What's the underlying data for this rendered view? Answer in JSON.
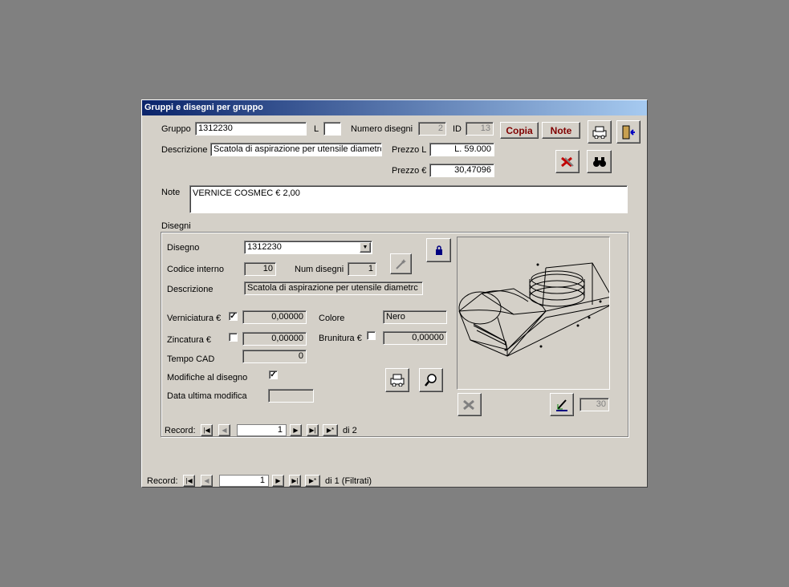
{
  "window": {
    "title": "Gruppi e disegni per gruppo"
  },
  "header": {
    "gruppo_label": "Gruppo",
    "gruppo_value": "1312230",
    "l_label": "L",
    "l_value": "",
    "numero_disegni_label": "Numero disegni",
    "numero_disegni_value": "2",
    "id_label": "ID",
    "id_value": "13",
    "copia_label": "Copia",
    "note_button_label": "Note",
    "descrizione_label": "Descrizione",
    "descrizione_value": "Scatola di aspirazione per utensile diametrc",
    "prezzo_l_label": "Prezzo L",
    "prezzo_l_value": "L. 59.000",
    "prezzo_e_label": "Prezzo €",
    "prezzo_e_value": "30,47096",
    "note_label": "Note",
    "note_value": "VERNICE COSMEC € 2,00"
  },
  "disegni": {
    "section_label": "Disegni",
    "disegno_label": "Disegno",
    "disegno_value": "1312230",
    "codice_interno_label": "Codice interno",
    "codice_interno_value": "10",
    "num_disegni_label": "Num disegni",
    "num_disegni_value": "1",
    "descrizione_label": "Descrizione",
    "descrizione_value": "Scatola di aspirazione per utensile diametrc",
    "verniciatura_label": "Verniciatura €",
    "verniciatura_checked": true,
    "verniciatura_value": "0,00000",
    "colore_label": "Colore",
    "colore_value": "Nero",
    "zincatura_label": "Zincatura €",
    "zincatura_checked": false,
    "zincatura_value": "0,00000",
    "brunitura_label": "Brunitura €",
    "brunitura_checked": false,
    "brunitura_value": "0,00000",
    "tempo_cad_label": "Tempo CAD",
    "tempo_cad_value": "0",
    "modifiche_label": "Modifiche al disegno",
    "modifiche_checked": true,
    "data_ultima_label": "Data ultima modifica",
    "data_ultima_value": "",
    "picture_counter": "30",
    "record_label": "Record:",
    "record_value": "1",
    "record_total": "di 2"
  },
  "footer": {
    "record_label": "Record:",
    "record_value": "1",
    "record_total": "di 1 (Filtrati)"
  },
  "icons": [
    "print-icon",
    "exit-door-icon",
    "delete-icon",
    "binoculars-icon",
    "lock-icon",
    "wand-icon",
    "zoom-icon",
    "delete-disabled-icon",
    "edit-drawing-icon",
    "first-icon",
    "prev-icon",
    "next-icon",
    "last-icon",
    "new-record-icon"
  ],
  "colors": {
    "title_start": "#0a246a",
    "title_end": "#a6caf0",
    "button_text": "#800000",
    "face": "#d4d0c8"
  }
}
